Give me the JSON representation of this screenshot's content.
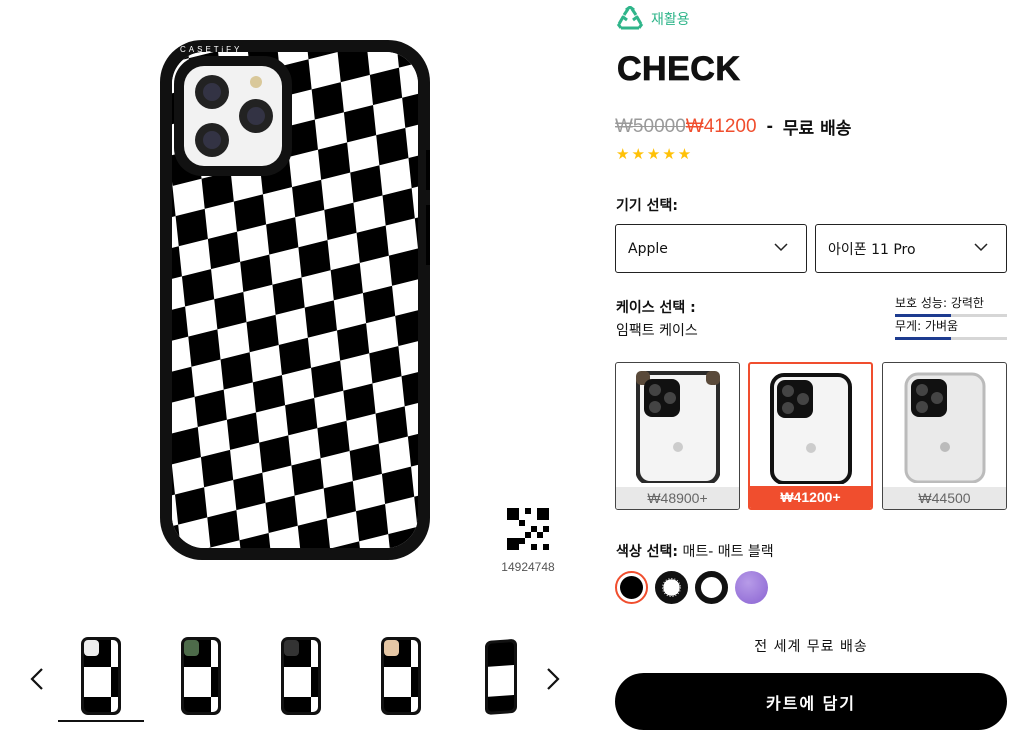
{
  "badge": {
    "icon": "recycle-icon",
    "label": "재활용",
    "color": "#2fb58a"
  },
  "product": {
    "title": "CHECK",
    "price_original": "₩50000",
    "price_sale": "₩41200",
    "separator": "-",
    "shipping_note": "무료 배송",
    "rating": "★★★★★",
    "hero_brand_text": "CASETiFY",
    "sku_code": "14924748"
  },
  "device": {
    "label": "기기 선택:",
    "brand": "Apple",
    "model": "아이폰 11 Pro"
  },
  "case": {
    "label": "케이스 선택 :",
    "value": "임팩트 케이스",
    "specs": [
      {
        "label": "보호 성능: 강력한",
        "level": 0.5
      },
      {
        "label": "무게: 가벼움",
        "level": 0.5
      }
    ],
    "options": [
      {
        "price": "₩48900+",
        "frame": "#2a2a2a",
        "selected": false
      },
      {
        "price": "₩41200+",
        "frame": "#111111",
        "selected": true
      },
      {
        "price": "₩44500",
        "frame": "#cfcfcf",
        "selected": false
      }
    ]
  },
  "color": {
    "label": "색상 선택:",
    "value": "매트- 매트 블랙",
    "swatches": [
      "matte-black",
      "speckled-black",
      "black-white-ring",
      "lavender"
    ]
  },
  "gallery": {
    "thumbnails": [
      "thumb-matte-black",
      "thumb-green",
      "thumb-black",
      "thumb-rose",
      "thumb-side"
    ]
  },
  "shipping_banner": "전 세계 무료 배송",
  "cart_button": "카트에 담기",
  "colors": {
    "accent": "#f04e2e",
    "recycle": "#2fb58a",
    "spec_bar": "#1d3b8f",
    "star": "#ffc107"
  }
}
